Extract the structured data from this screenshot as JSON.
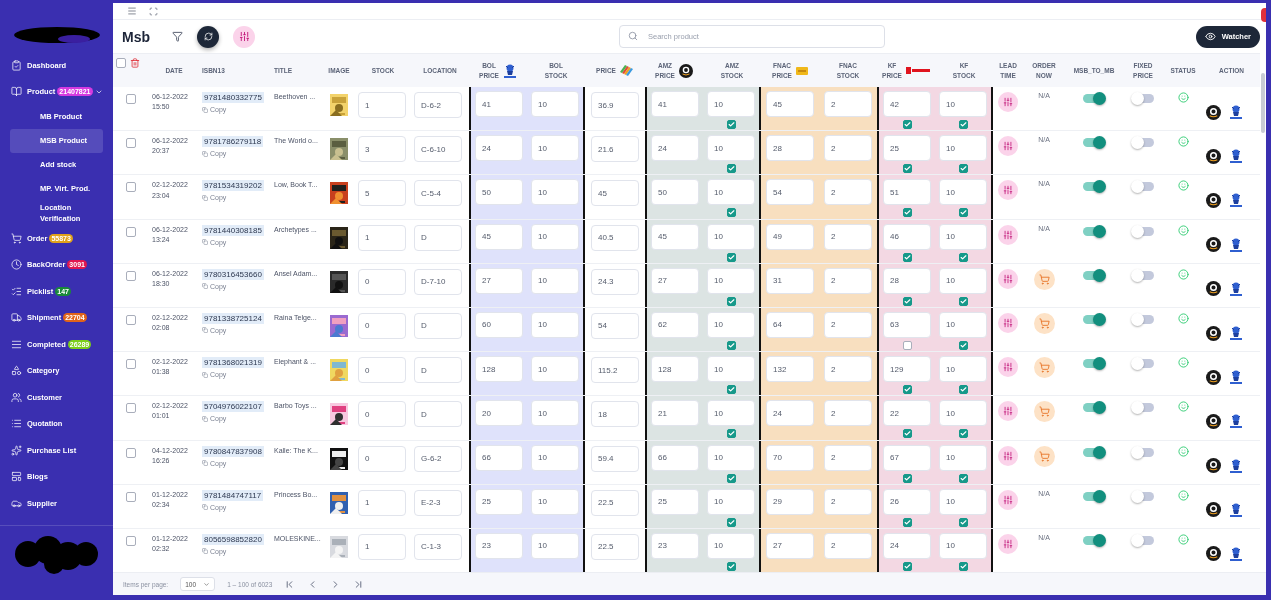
{
  "sidebar": {
    "items": [
      {
        "label": "Dashboard",
        "selected": false
      },
      {
        "label": "Product",
        "badge": "21407821",
        "color": "#d63ae0",
        "expanded": true,
        "selected": false,
        "children": [
          {
            "label": "MB Product",
            "selected": false
          },
          {
            "label": "MSB Product",
            "selected": true
          },
          {
            "label": "Add stock",
            "selected": false
          },
          {
            "label": "MP. Virt. Prod.",
            "selected": false
          },
          {
            "label": "Location Verification",
            "selected": false
          }
        ]
      },
      {
        "label": "Order",
        "badge": "55873",
        "color": "#e0a21a",
        "selected": false
      },
      {
        "label": "BackOrder",
        "badge": "3091",
        "color": "#e0174f",
        "selected": false
      },
      {
        "label": "Picklist",
        "badge": "147",
        "color": "#1a8a3a",
        "selected": false
      },
      {
        "label": "Shipment",
        "badge": "22704",
        "color": "#e0641a",
        "selected": false
      },
      {
        "label": "Completed",
        "badge": "26289",
        "color": "#7ccf1a",
        "selected": false
      },
      {
        "label": "Category",
        "selected": false
      },
      {
        "label": "Customer",
        "selected": false
      },
      {
        "label": "Quotation",
        "selected": false
      },
      {
        "label": "Purchase List",
        "selected": false
      },
      {
        "label": "Blogs",
        "selected": false
      },
      {
        "label": "Supplier",
        "selected": false
      }
    ]
  },
  "header": {
    "title": "Msb",
    "search": {
      "placeholder": "Search product"
    },
    "watcher_button": "Watcher"
  },
  "table": {
    "select_all": false,
    "columns": [
      "DATE",
      "ISBN13",
      "TITLE",
      "IMAGE",
      "STOCK",
      "LOCATION",
      "BOL PRICE",
      "BOL STOCK",
      "PRICE",
      "AMZ PRICE",
      "AMZ STOCK",
      "FNAC PRICE",
      "FNAC STOCK",
      "KF PRICE",
      "KF STOCK",
      "LEAD TIME",
      "ORDER NOW",
      "MSB_TO_MB",
      "FIXED PRICE",
      "STATUS",
      "ACTION"
    ],
    "rows": [
      {
        "selected": false,
        "date": "06-12-2022 15:50",
        "isbn": "9781480332775",
        "copy": "Copy",
        "title": "Beethoven ...",
        "stock": "1",
        "location": "D-6-2",
        "bol": {
          "price": "41",
          "stock": "10"
        },
        "price": "36.9",
        "amz": {
          "price": "41",
          "stock": "10",
          "checked": true
        },
        "fnac": {
          "price": "45",
          "stock": "2"
        },
        "kf": {
          "price": "42",
          "stock": "10",
          "price_checked": true,
          "stock_checked": true
        },
        "order_now": {
          "kind": "text",
          "text": "N/A"
        },
        "msb_to_mb": true,
        "fixed_price": false
      },
      {
        "selected": false,
        "date": "06-12-2022 20:37",
        "isbn": "9781786279118",
        "copy": "Copy",
        "title": "The World o...",
        "stock": "3",
        "location": "C-6-10",
        "bol": {
          "price": "24",
          "stock": "10"
        },
        "price": "21.6",
        "amz": {
          "price": "24",
          "stock": "10",
          "checked": true
        },
        "fnac": {
          "price": "28",
          "stock": "2"
        },
        "kf": {
          "price": "25",
          "stock": "10",
          "price_checked": true,
          "stock_checked": true
        },
        "order_now": {
          "kind": "text",
          "text": "N/A"
        },
        "msb_to_mb": true,
        "fixed_price": false
      },
      {
        "selected": false,
        "date": "02-12-2022 23:04",
        "isbn": "9781534319202",
        "copy": "Copy",
        "title": "Low, Book T...",
        "stock": "5",
        "location": "C-5-4",
        "bol": {
          "price": "50",
          "stock": "10"
        },
        "price": "45",
        "amz": {
          "price": "50",
          "stock": "10",
          "checked": true
        },
        "fnac": {
          "price": "54",
          "stock": "2"
        },
        "kf": {
          "price": "51",
          "stock": "10",
          "price_checked": true,
          "stock_checked": true
        },
        "order_now": {
          "kind": "text",
          "text": "N/A"
        },
        "msb_to_mb": true,
        "fixed_price": false
      },
      {
        "selected": false,
        "date": "06-12-2022 13:24",
        "isbn": "9781440308185",
        "copy": "Copy",
        "title": "Archetypes ...",
        "stock": "1",
        "location": "D",
        "bol": {
          "price": "45",
          "stock": "10"
        },
        "price": "40.5",
        "amz": {
          "price": "45",
          "stock": "10",
          "checked": true
        },
        "fnac": {
          "price": "49",
          "stock": "2"
        },
        "kf": {
          "price": "46",
          "stock": "10",
          "price_checked": true,
          "stock_checked": true
        },
        "order_now": {
          "kind": "text",
          "text": "N/A"
        },
        "msb_to_mb": true,
        "fixed_price": false
      },
      {
        "selected": false,
        "date": "06-12-2022 18:30",
        "isbn": "9780316453660",
        "copy": "Copy",
        "title": "Ansel Adam...",
        "stock": "0",
        "location": "D-7-10",
        "bol": {
          "price": "27",
          "stock": "10"
        },
        "price": "24.3",
        "amz": {
          "price": "27",
          "stock": "10",
          "checked": true
        },
        "fnac": {
          "price": "31",
          "stock": "2"
        },
        "kf": {
          "price": "28",
          "stock": "10",
          "price_checked": true,
          "stock_checked": true
        },
        "order_now": {
          "kind": "cart"
        },
        "msb_to_mb": true,
        "fixed_price": false
      },
      {
        "selected": false,
        "date": "02-12-2022 02:08",
        "isbn": "9781338725124",
        "copy": "Copy",
        "title": "Raina Telge...",
        "stock": "0",
        "location": "D",
        "bol": {
          "price": "60",
          "stock": "10"
        },
        "price": "54",
        "amz": {
          "price": "62",
          "stock": "10",
          "checked": true
        },
        "fnac": {
          "price": "64",
          "stock": "2"
        },
        "kf": {
          "price": "63",
          "stock": "10",
          "price_checked": false,
          "stock_checked": true
        },
        "order_now": {
          "kind": "cart"
        },
        "msb_to_mb": true,
        "fixed_price": false
      },
      {
        "selected": false,
        "date": "02-12-2022 01:38",
        "isbn": "9781368021319",
        "copy": "Copy",
        "title": "Elephant & ...",
        "stock": "0",
        "location": "D",
        "bol": {
          "price": "128",
          "stock": "10"
        },
        "price": "115.2",
        "amz": {
          "price": "128",
          "stock": "10",
          "checked": true
        },
        "fnac": {
          "price": "132",
          "stock": "2"
        },
        "kf": {
          "price": "129",
          "stock": "10",
          "price_checked": true,
          "stock_checked": true
        },
        "order_now": {
          "kind": "cart"
        },
        "msb_to_mb": true,
        "fixed_price": false
      },
      {
        "selected": false,
        "date": "02-12-2022 01:01",
        "isbn": "5704976022107",
        "copy": "Copy",
        "title": "Barbo Toys ...",
        "stock": "0",
        "location": "D",
        "bol": {
          "price": "20",
          "stock": "10"
        },
        "price": "18",
        "amz": {
          "price": "21",
          "stock": "10",
          "checked": true
        },
        "fnac": {
          "price": "24",
          "stock": "2"
        },
        "kf": {
          "price": "22",
          "stock": "10",
          "price_checked": true,
          "stock_checked": true
        },
        "order_now": {
          "kind": "cart"
        },
        "msb_to_mb": true,
        "fixed_price": false
      },
      {
        "selected": false,
        "date": "04-12-2022 16:26",
        "isbn": "9780847837908",
        "copy": "Copy",
        "title": "Kalle: The K...",
        "stock": "0",
        "location": "G-6-2",
        "bol": {
          "price": "66",
          "stock": "10"
        },
        "price": "59.4",
        "amz": {
          "price": "66",
          "stock": "10",
          "checked": true
        },
        "fnac": {
          "price": "70",
          "stock": "2"
        },
        "kf": {
          "price": "67",
          "stock": "10",
          "price_checked": true,
          "stock_checked": true
        },
        "order_now": {
          "kind": "cart"
        },
        "msb_to_mb": true,
        "fixed_price": false
      },
      {
        "selected": false,
        "date": "01-12-2022 02:34",
        "isbn": "9781484747117",
        "copy": "Copy",
        "title": "Princess Bo...",
        "stock": "1",
        "location": "E-2-3",
        "bol": {
          "price": "25",
          "stock": "10"
        },
        "price": "22.5",
        "amz": {
          "price": "25",
          "stock": "10",
          "checked": true
        },
        "fnac": {
          "price": "29",
          "stock": "2"
        },
        "kf": {
          "price": "26",
          "stock": "10",
          "price_checked": true,
          "stock_checked": true
        },
        "order_now": {
          "kind": "text",
          "text": "N/A"
        },
        "msb_to_mb": true,
        "fixed_price": false
      },
      {
        "selected": false,
        "date": "01-12-2022 02:32",
        "isbn": "8056598852820",
        "copy": "Copy",
        "title": "MOLESKINE...",
        "stock": "1",
        "location": "C-1-3",
        "bol": {
          "price": "23",
          "stock": "10"
        },
        "price": "22.5",
        "amz": {
          "price": "23",
          "stock": "10",
          "checked": true
        },
        "fnac": {
          "price": "27",
          "stock": "2"
        },
        "kf": {
          "price": "24",
          "stock": "10",
          "price_checked": true,
          "stock_checked": true
        },
        "order_now": {
          "kind": "text",
          "text": "N/A"
        },
        "msb_to_mb": true,
        "fixed_price": false
      }
    ]
  },
  "paginator": {
    "label": "Items per page:",
    "page_size": "100",
    "range": "1 – 100 of 6023"
  }
}
